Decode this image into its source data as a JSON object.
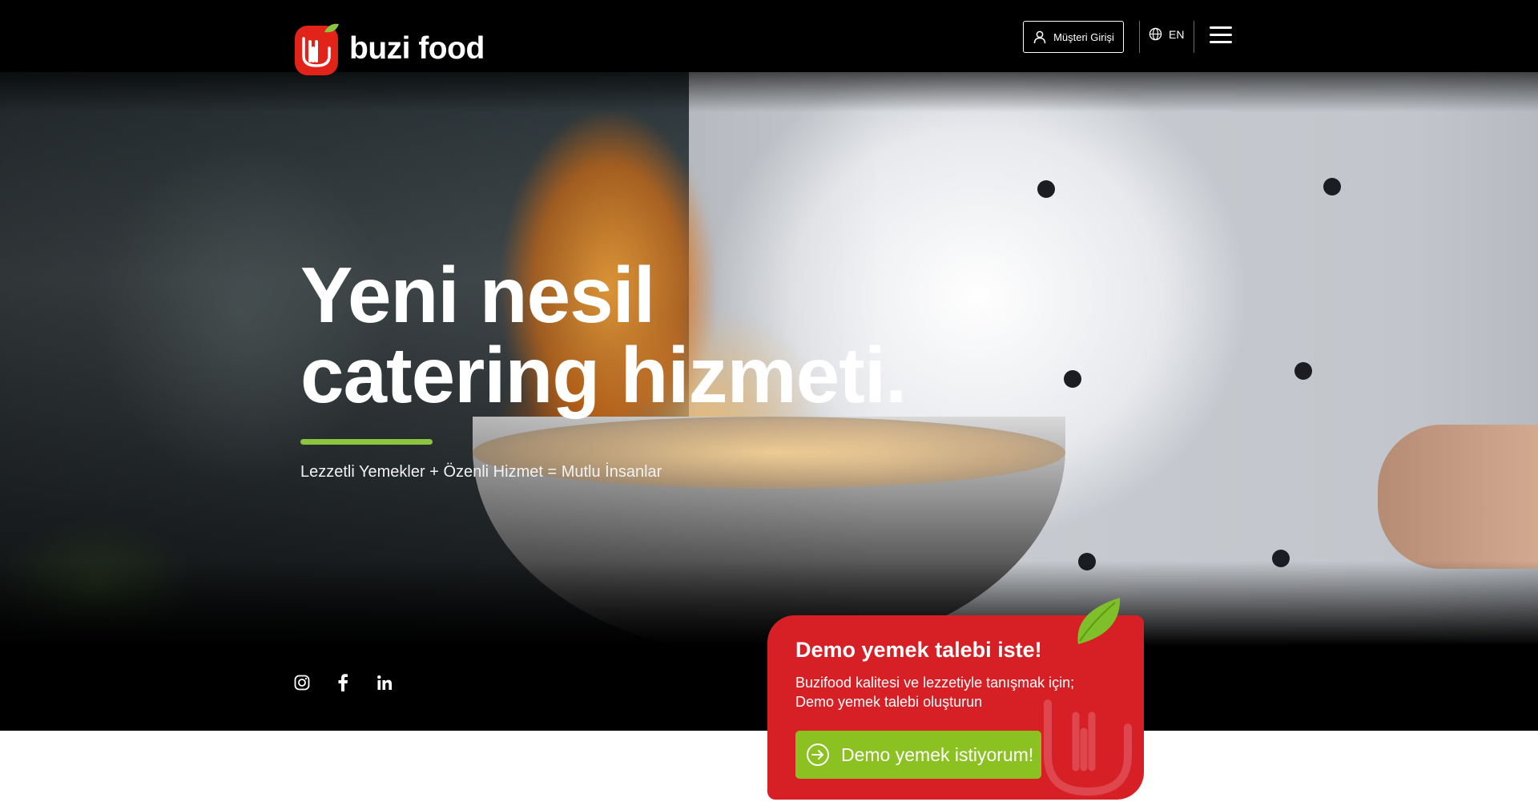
{
  "brand": {
    "name": "buzi food",
    "green": "#8cc63f",
    "red": "#d71f26"
  },
  "header": {
    "login_label": "Müşteri Girişi",
    "login_icon": "user-icon",
    "lang_label": "EN",
    "lang_icon": "globe-icon",
    "menu_icon": "hamburger-menu-icon"
  },
  "hero": {
    "headline_line1": "Yeni nesil",
    "headline_line2": "catering hizmeti.",
    "tagline": "Lezzetli Yemekler + Özenli Hizmet = Mutlu İnsanlar"
  },
  "social": [
    {
      "name": "instagram-icon",
      "glyph": "◎"
    },
    {
      "name": "facebook-icon",
      "glyph": "f"
    },
    {
      "name": "linkedin-icon",
      "glyph": "in"
    }
  ],
  "demo": {
    "title": "Demo yemek talebi iste!",
    "text": "Buzifood kalitesi ve lezzetiyle tanışmak için; Demo yemek talebi oluşturun",
    "cta_label": "Demo yemek istiyorum!",
    "cta_icon": "arrow-right-circle-icon"
  }
}
